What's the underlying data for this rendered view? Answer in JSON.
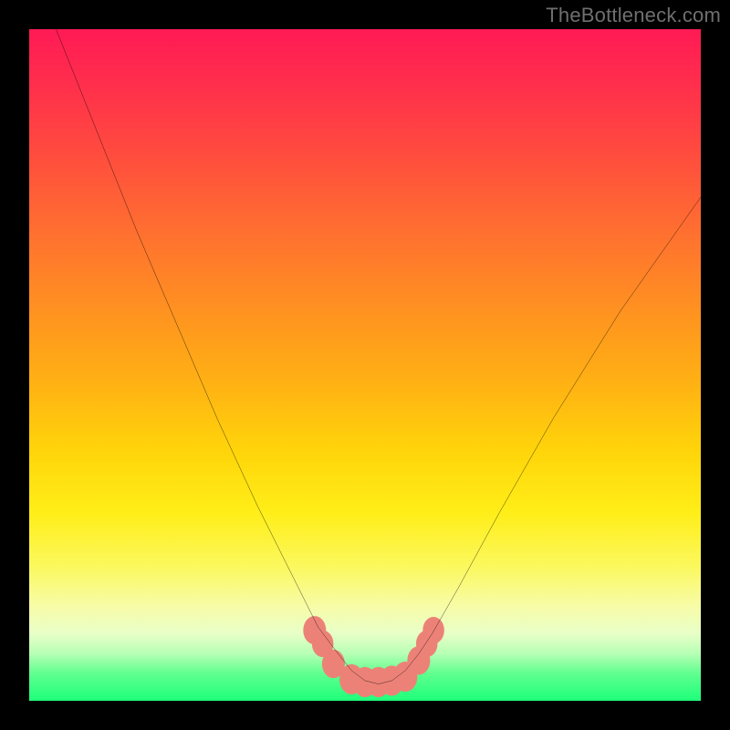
{
  "watermark": "TheBottleneck.com",
  "chart_data": {
    "type": "line",
    "title": "",
    "xlabel": "",
    "ylabel": "",
    "xlim": [
      0,
      100
    ],
    "ylim": [
      0,
      100
    ],
    "series": [
      {
        "name": "curve",
        "x": [
          4,
          10,
          16,
          22,
          28,
          34,
          40,
          43,
          46,
          48,
          50,
          52,
          54,
          56,
          58,
          60,
          64,
          70,
          78,
          88,
          100
        ],
        "y": [
          100,
          85,
          70,
          56,
          42,
          29,
          17,
          11,
          7,
          4.5,
          3,
          2.5,
          3,
          4.5,
          7,
          10,
          17,
          28,
          42,
          58,
          75
        ]
      }
    ],
    "markers": {
      "name": "bottom-blobs",
      "color": "#ec8277",
      "points": [
        {
          "x": 42.5,
          "y": 10.5,
          "r": 1.7
        },
        {
          "x": 43.7,
          "y": 8.5,
          "r": 1.6
        },
        {
          "x": 45.3,
          "y": 5.5,
          "r": 1.7
        },
        {
          "x": 48.0,
          "y": 3.2,
          "r": 1.8
        },
        {
          "x": 50.0,
          "y": 2.8,
          "r": 1.8
        },
        {
          "x": 52.0,
          "y": 2.8,
          "r": 1.8
        },
        {
          "x": 54.0,
          "y": 3.0,
          "r": 1.8
        },
        {
          "x": 56.0,
          "y": 3.6,
          "r": 1.8
        },
        {
          "x": 58.0,
          "y": 6.0,
          "r": 1.7
        },
        {
          "x": 59.2,
          "y": 8.5,
          "r": 1.6
        },
        {
          "x": 60.2,
          "y": 10.5,
          "r": 1.6
        }
      ]
    },
    "background": {
      "type": "vertical-gradient",
      "stops": [
        {
          "pos": 0,
          "color": "#ff1a55"
        },
        {
          "pos": 50,
          "color": "#ffb213"
        },
        {
          "pos": 80,
          "color": "#fbf85e"
        },
        {
          "pos": 100,
          "color": "#1eff7a"
        }
      ]
    }
  }
}
